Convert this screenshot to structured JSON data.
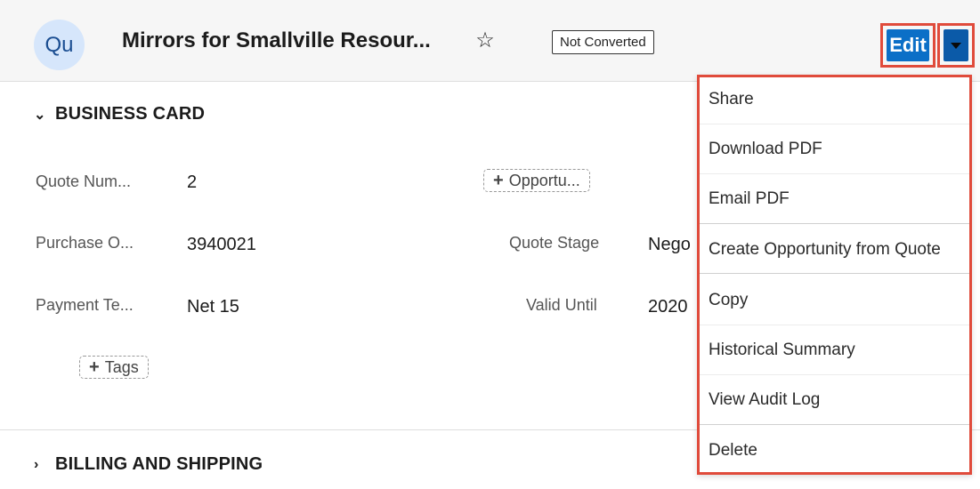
{
  "header": {
    "avatar_text": "Qu",
    "title": "Mirrors for Smallville Resour...",
    "star_icon": "☆",
    "status_badge": "Not Converted",
    "edit_label": "Edit"
  },
  "sections": {
    "business_card": "BUSINESS CARD",
    "billing_shipping": "BILLING AND SHIPPING"
  },
  "fields": {
    "quote_number_label": "Quote Num...",
    "quote_number_value": "2",
    "opportunity_button": "Opportu...",
    "purchase_order_label": "Purchase O...",
    "purchase_order_value": "3940021",
    "quote_stage_label": "Quote Stage",
    "quote_stage_value": "Nego",
    "payment_terms_label": "Payment Te...",
    "payment_terms_value": "Net 15",
    "valid_until_label": "Valid Until",
    "valid_until_value": "2020",
    "tags_button": "Tags"
  },
  "menu": {
    "items": [
      "Share",
      "Download PDF",
      "Email PDF",
      "Create Opportunity from Quote",
      "Copy",
      "Historical Summary",
      "View Audit Log",
      "Delete"
    ]
  },
  "colors": {
    "accent": "#0b6fc7",
    "highlight": "#e04b3b",
    "avatar_bg": "#d6e6fb"
  }
}
